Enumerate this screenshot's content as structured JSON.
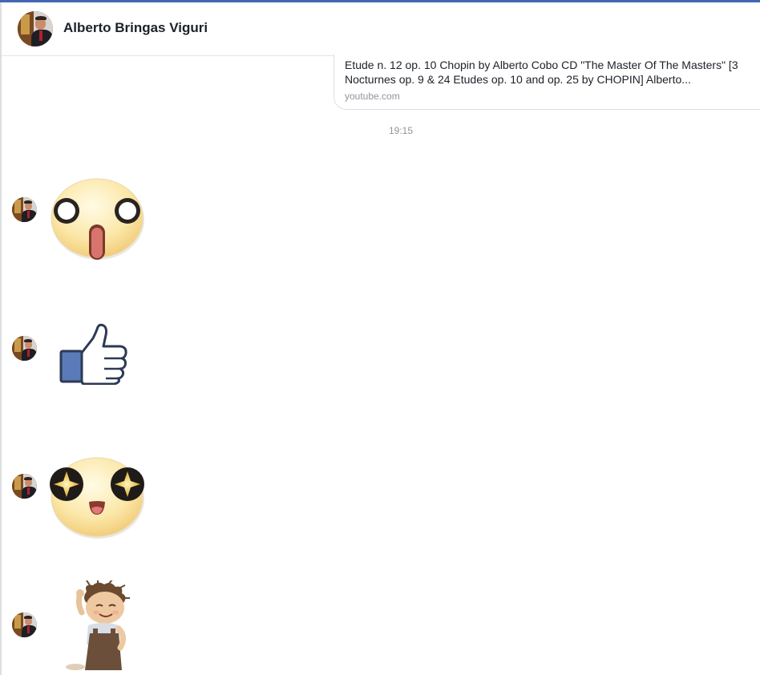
{
  "header": {
    "name": "Alberto Bringas Viguri"
  },
  "link_preview": {
    "title": "Etude n. 12 op. 10 Chopin by Alberto Cobo CD \"The Master Of The Masters\" [3 Nocturnes op. 9 & 24 Etudes op. 10 and op. 25 by CHOPIN] Alberto...",
    "domain": "youtube.com"
  },
  "timestamp": "19:15",
  "messages": [
    {
      "sticker": "surprised-face-sticker"
    },
    {
      "sticker": "thumbs-up-sticker"
    },
    {
      "sticker": "starry-eyes-face-sticker"
    },
    {
      "sticker": "happy-kid-dancing-sticker"
    }
  ],
  "colors": {
    "accent": "#4267b2",
    "divider": "#dddfe2",
    "meta_text": "#90949c",
    "like_blue": "#5b7bb8"
  }
}
